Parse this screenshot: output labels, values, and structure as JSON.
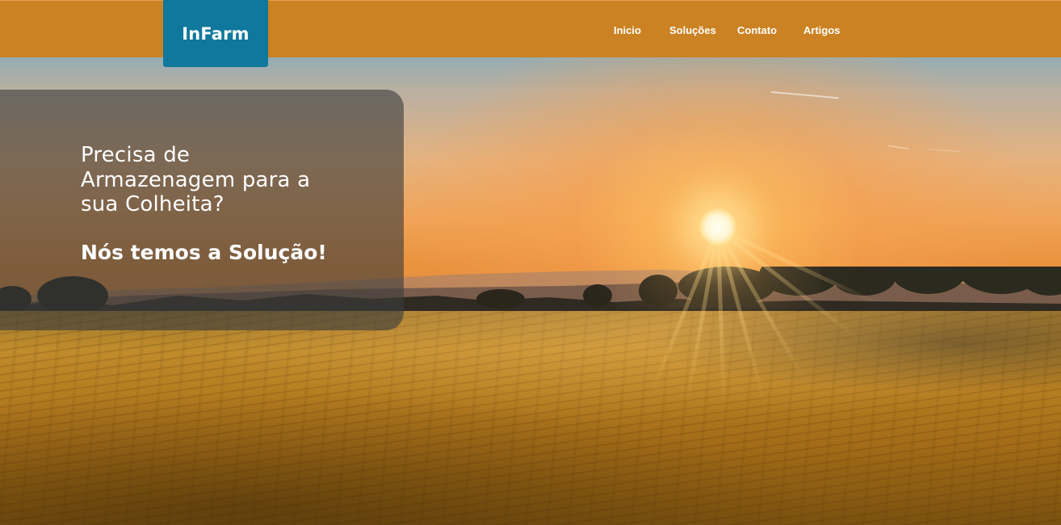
{
  "brand": {
    "logo_text": "InFarm",
    "colors": {
      "header": "#cb8222",
      "logo_bg": "#0f789c",
      "card_overlay": "rgba(60,60,60,0.62)",
      "text": "#ffffff"
    }
  },
  "nav": {
    "items": [
      {
        "label": "Inicio"
      },
      {
        "label": "Soluções"
      },
      {
        "label": "Contato"
      },
      {
        "label": "Artigos"
      }
    ]
  },
  "hero": {
    "headline": "Precisa de Armazenagem para a sua Colheita?",
    "subheadline": "Nós temos a Solução!",
    "background": "sunset-wheat-field-image"
  }
}
